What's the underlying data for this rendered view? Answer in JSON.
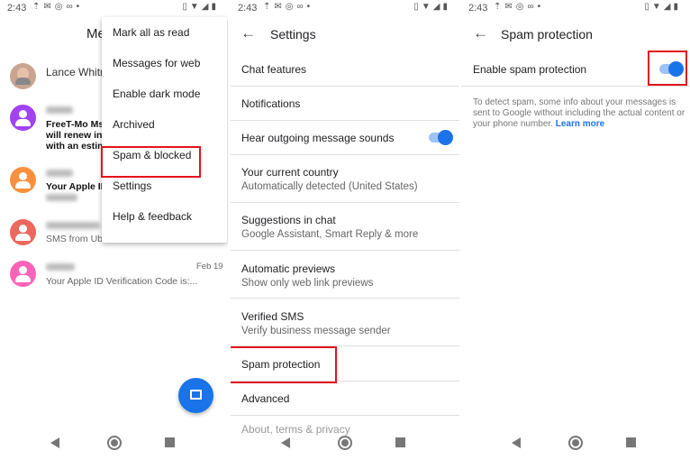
{
  "status": {
    "time": "2:43"
  },
  "messages": {
    "title": "Me",
    "conversations": [
      {
        "name": "Lance Whitn",
        "preview": "",
        "date": "",
        "color": "#9e9e9e"
      },
      {
        "name": "",
        "preview_lines": [
          "FreeT-Mo Msg",
          "will renew in t",
          "with an estim"
        ],
        "color": "#a142f4"
      },
      {
        "name": "",
        "preview_lines": [
          "Your Apple ID"
        ],
        "color": "#fa903e"
      },
      {
        "name": "",
        "preview": "SMS from Ube",
        "color": "#ee675c"
      },
      {
        "name": "",
        "preview": "Your Apple ID Verification Code is:...",
        "date": "Feb 19",
        "color": "#ff63b8"
      }
    ],
    "menu": [
      "Mark all as read",
      "Messages for web",
      "Enable dark mode",
      "Archived",
      "Spam & blocked",
      "Settings",
      "Help & feedback"
    ]
  },
  "settings": {
    "title": "Settings",
    "items": [
      {
        "title": "Chat features"
      },
      {
        "title": "Notifications"
      },
      {
        "title": "Hear outgoing message sounds",
        "toggle": true
      },
      {
        "title": "Your current country",
        "subtitle": "Automatically detected (United States)"
      },
      {
        "title": "Suggestions in chat",
        "subtitle": "Google Assistant, Smart Reply & more"
      },
      {
        "title": "Automatic previews",
        "subtitle": "Show only web link previews"
      },
      {
        "title": "Verified SMS",
        "subtitle": "Verify business message sender"
      },
      {
        "title": "Spam protection"
      },
      {
        "title": "Advanced"
      },
      {
        "title": "About, terms & privacy"
      }
    ]
  },
  "spam": {
    "title": "Spam protection",
    "toggle_label": "Enable spam protection",
    "enabled": true,
    "description": "To detect spam, some info about your messages is sent to Google without including the actual content or your phone number.",
    "learn_more": "Learn more"
  },
  "colors": {
    "accent": "#1a73e8",
    "highlight": "#e3131b"
  }
}
